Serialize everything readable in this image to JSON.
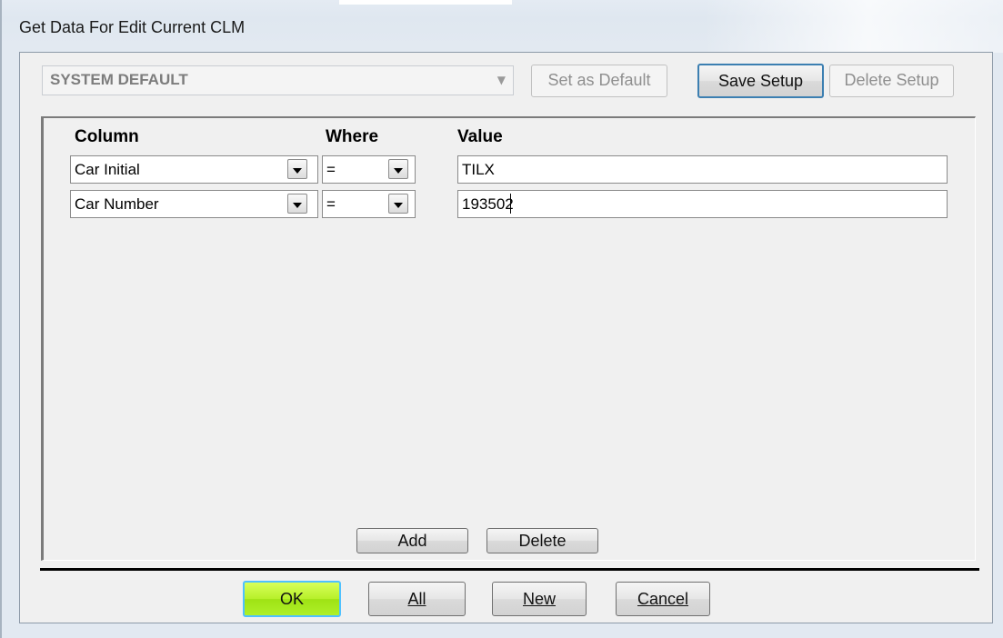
{
  "window": {
    "title": "Get Data For Edit Current CLM"
  },
  "setup": {
    "selected": "SYSTEM DEFAULT",
    "set_default_label": "Set as Default",
    "save_label": "Save Setup",
    "delete_label": "Delete Setup"
  },
  "criteria": {
    "headers": {
      "column": "Column",
      "where": "Where",
      "value": "Value"
    },
    "rows": [
      {
        "column": "Car Initial",
        "operator": "=",
        "value": "TILX"
      },
      {
        "column": "Car Number",
        "operator": "=",
        "value": "193502"
      }
    ],
    "add_label": "Add",
    "delete_label": "Delete"
  },
  "footer": {
    "ok_label": "OK",
    "all_label": "All",
    "new_label": "New",
    "cancel_label": "Cancel"
  },
  "colors": {
    "ok_button": "#b7f02a",
    "ok_border": "#4fc1ff",
    "frame": "#dfe7f0"
  }
}
